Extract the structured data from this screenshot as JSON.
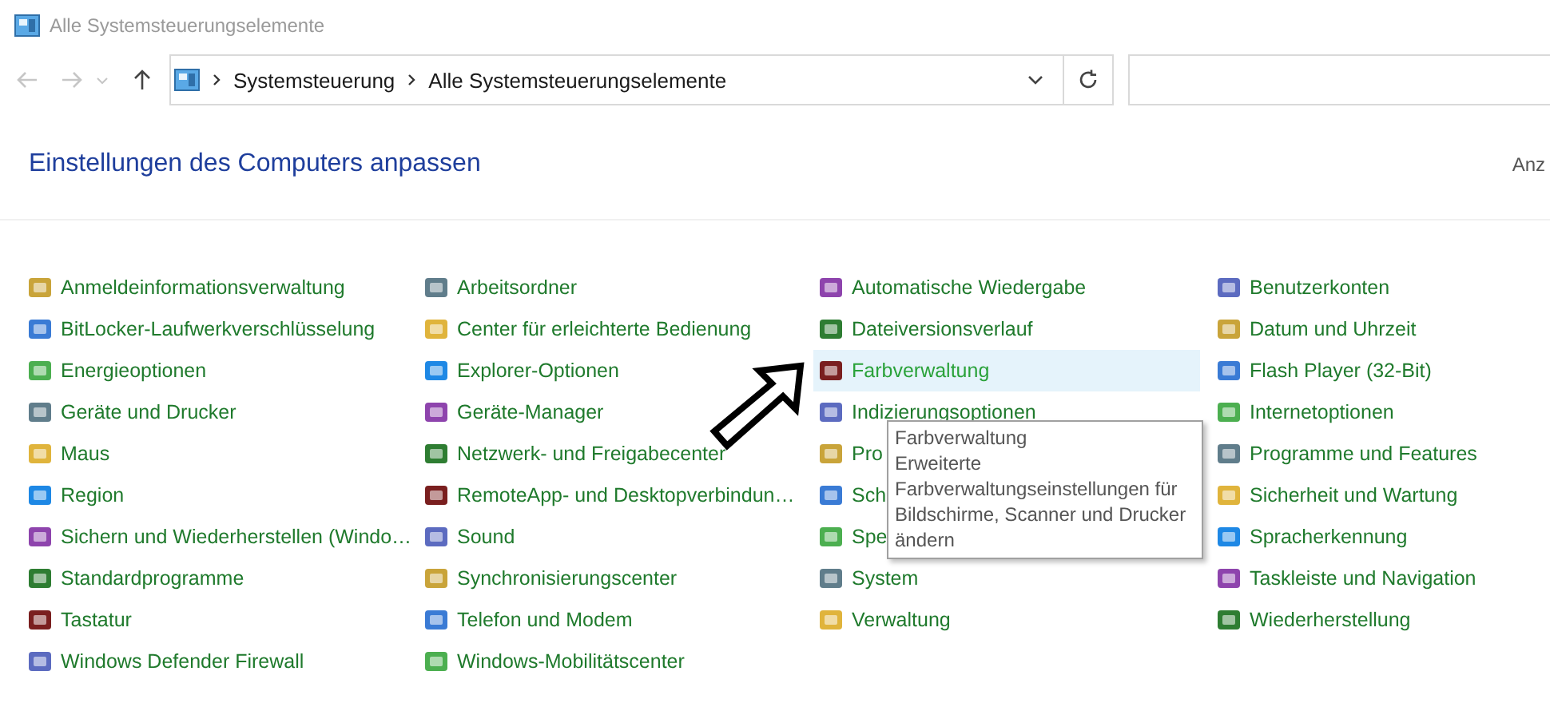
{
  "window": {
    "title": "Alle Systemsteuerungselemente"
  },
  "address_bar": {
    "breadcrumbs": [
      "Systemsteuerung",
      "Alle Systemsteuerungselemente"
    ]
  },
  "heading": "Einstellungen des Computers anpassen",
  "view_label": "Anz",
  "columns": [
    [
      {
        "label": "Anmeldeinformationsverwaltung",
        "hovered": false
      },
      {
        "label": "BitLocker-Laufwerkverschlüsselung",
        "hovered": false
      },
      {
        "label": "Energieoptionen",
        "hovered": false
      },
      {
        "label": "Geräte und Drucker",
        "hovered": false
      },
      {
        "label": "Maus",
        "hovered": false
      },
      {
        "label": "Region",
        "hovered": false
      },
      {
        "label": "Sichern und Wiederherstellen (Windo…",
        "hovered": false
      },
      {
        "label": "Standardprogramme",
        "hovered": false
      },
      {
        "label": "Tastatur",
        "hovered": false
      },
      {
        "label": "Windows Defender Firewall",
        "hovered": false
      }
    ],
    [
      {
        "label": "Arbeitsordner",
        "hovered": false
      },
      {
        "label": "Center für erleichterte Bedienung",
        "hovered": false
      },
      {
        "label": "Explorer-Optionen",
        "hovered": false
      },
      {
        "label": "Geräte-Manager",
        "hovered": false
      },
      {
        "label": "Netzwerk- und Freigabecenter",
        "hovered": false
      },
      {
        "label": "RemoteApp- und Desktopverbindun…",
        "hovered": false
      },
      {
        "label": "Sound",
        "hovered": false
      },
      {
        "label": "Synchronisierungscenter",
        "hovered": false
      },
      {
        "label": "Telefon und Modem",
        "hovered": false
      },
      {
        "label": "Windows-Mobilitätscenter",
        "hovered": false
      }
    ],
    [
      {
        "label": "Automatische Wiedergabe",
        "hovered": false
      },
      {
        "label": "Dateiversionsverlauf",
        "hovered": false
      },
      {
        "label": "Farbverwaltung",
        "hovered": true
      },
      {
        "label": "Indizierungsoptionen",
        "hovered": false
      },
      {
        "label": "Pro",
        "hovered": false
      },
      {
        "label": "Sch",
        "hovered": false
      },
      {
        "label": "Spe",
        "hovered": false
      },
      {
        "label": "System",
        "hovered": false
      },
      {
        "label": "Verwaltung",
        "hovered": false
      }
    ],
    [
      {
        "label": "Benutzerkonten",
        "hovered": false
      },
      {
        "label": "Datum und Uhrzeit",
        "hovered": false
      },
      {
        "label": "Flash Player (32-Bit)",
        "hovered": false
      },
      {
        "label": "Internetoptionen",
        "hovered": false
      },
      {
        "label": "Programme und Features",
        "hovered": false
      },
      {
        "label": "Sicherheit und Wartung",
        "hovered": false
      },
      {
        "label": "Spracherkennung",
        "hovered": false
      },
      {
        "label": "Taskleiste und Navigation",
        "hovered": false
      },
      {
        "label": "Wiederherstellung",
        "hovered": false
      }
    ]
  ],
  "tooltip": {
    "title": "Farbverwaltung",
    "text": "Erweiterte Farbverwaltungseinstellungen für Bildschirme, Scanner und Drucker ändern"
  }
}
